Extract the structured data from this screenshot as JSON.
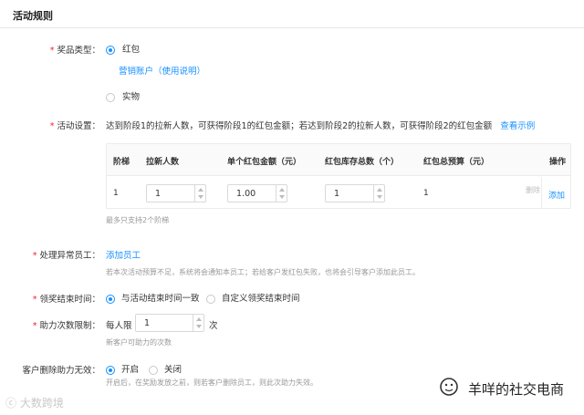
{
  "section_title": "活动规则",
  "prize_type": {
    "label": "奖品类型：",
    "option_red": "红包",
    "account_link": "营销账户（使用说明）",
    "option_item": "实物"
  },
  "activity_settings": {
    "label": "活动设置：",
    "desc": "达到阶段1的拉新人数，可获得阶段1的红包金额；若达到阶段2的拉新人数，可获得阶段2的红包金额",
    "example_link": "查看示例",
    "table": {
      "headers": [
        "阶梯",
        "拉新人数",
        "单个红包金额（元）",
        "红包库存总数（个）",
        "红包总预算（元）",
        "操作"
      ],
      "row": {
        "step": "1",
        "new_users": "1",
        "amount": "1.00",
        "stock": "1",
        "budget": "1",
        "delete": "删除",
        "add": "添加"
      }
    },
    "hint": "最多只支持2个阶梯"
  },
  "exception_staff": {
    "label": "处理异常员工：",
    "add_link": "添加员工",
    "hint": "若本次活动预算不足，系统将会通知本员工；若给客户发红包失败，也将会引导客户添加此员工。"
  },
  "claim_end": {
    "label": "领奖结束时间：",
    "option_same": "与活动结束时间一致",
    "option_custom": "自定义领奖结束时间"
  },
  "assist_limit": {
    "label": "助力次数限制：",
    "prefix": "每人限",
    "value": "1",
    "suffix": "次",
    "hint": "新客户可助力的次数"
  },
  "delete_invalid": {
    "label": "客户删除助力无效：",
    "option_on": "开启",
    "option_off": "关闭",
    "hint": "开启后，在奖励发放之前，则若客户删除员工，则此次助力失效。"
  },
  "watermarks": {
    "right": "羊咩的社交电商",
    "left": "大数跨境"
  }
}
